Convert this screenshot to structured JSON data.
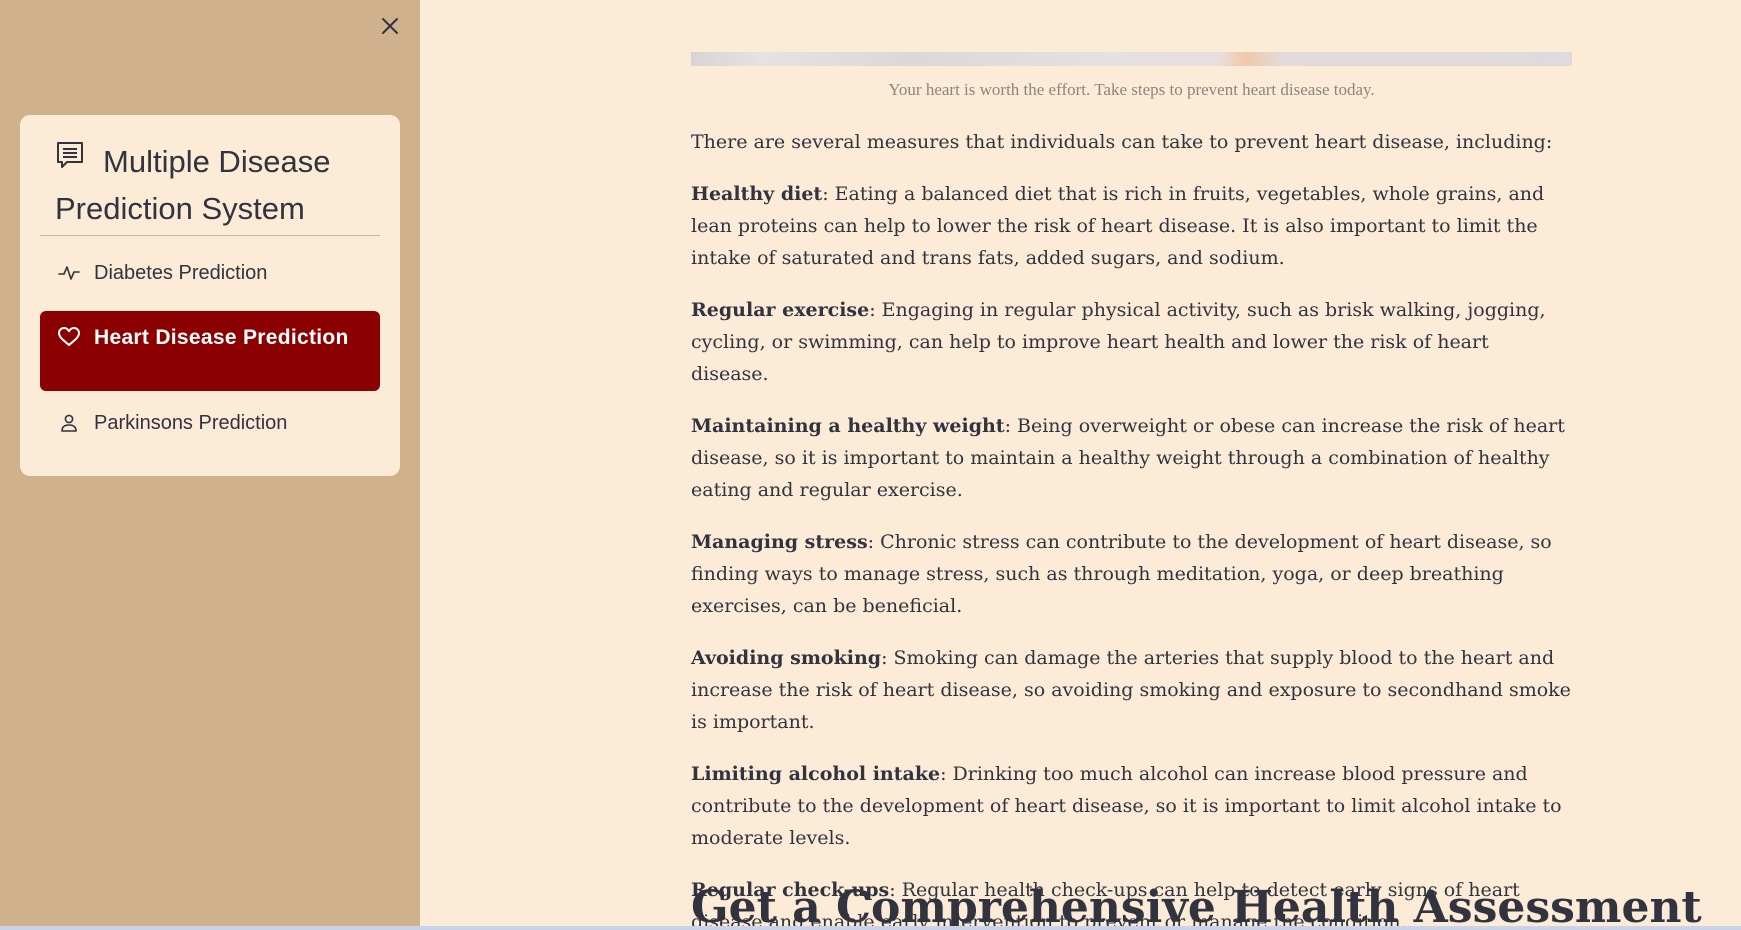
{
  "sidebar": {
    "close_icon": "close-icon",
    "title": "Multiple Disease Prediction System",
    "title_icon": "list-alt-icon",
    "items": [
      {
        "label": "Diabetes Prediction",
        "icon": "activity-icon",
        "active": false
      },
      {
        "label": "Heart Disease Prediction",
        "icon": "heart-icon",
        "active": true
      },
      {
        "label": "Parkinsons Prediction",
        "icon": "person-icon",
        "active": false
      }
    ],
    "active_color": "#8b0000",
    "background_color": "#cfb28c",
    "card_color": "#fbebd7"
  },
  "main": {
    "caption": "Your heart is worth the effort. Take steps to prevent heart disease today.",
    "intro": "There are several measures that individuals can take to prevent heart disease, including:",
    "measures": [
      {
        "term": "Healthy diet",
        "text": ": Eating a balanced diet that is rich in fruits, vegetables, whole grains, and lean proteins can help to lower the risk of heart disease. It is also important to limit the intake of saturated and trans fats, added sugars, and sodium."
      },
      {
        "term": "Regular exercise",
        "text": ": Engaging in regular physical activity, such as brisk walking, jogging, cycling, or swimming, can help to improve heart health and lower the risk of heart disease."
      },
      {
        "term": "Maintaining a healthy weight",
        "text": ": Being overweight or obese can increase the risk of heart disease, so it is important to maintain a healthy weight through a combination of healthy eating and regular exercise."
      },
      {
        "term": "Managing stress",
        "text": ": Chronic stress can contribute to the development of heart disease, so finding ways to manage stress, such as through meditation, yoga, or deep breathing exercises, can be beneficial."
      },
      {
        "term": "Avoiding smoking",
        "text": ": Smoking can damage the arteries that supply blood to the heart and increase the risk of heart disease, so avoiding smoking and exposure to secondhand smoke is important."
      },
      {
        "term": "Limiting alcohol intake",
        "text": ": Drinking too much alcohol can increase blood pressure and contribute to the development of heart disease, so it is important to limit alcohol intake to moderate levels."
      },
      {
        "term": "Regular check-ups",
        "text": ": Regular health check-ups can help to detect early signs of heart disease and enable early intervention to prevent or manage the condition."
      }
    ],
    "heading": "Get a Comprehensive Health Assessment",
    "background_color": "#fbebd7",
    "text_color": "#31333f"
  }
}
